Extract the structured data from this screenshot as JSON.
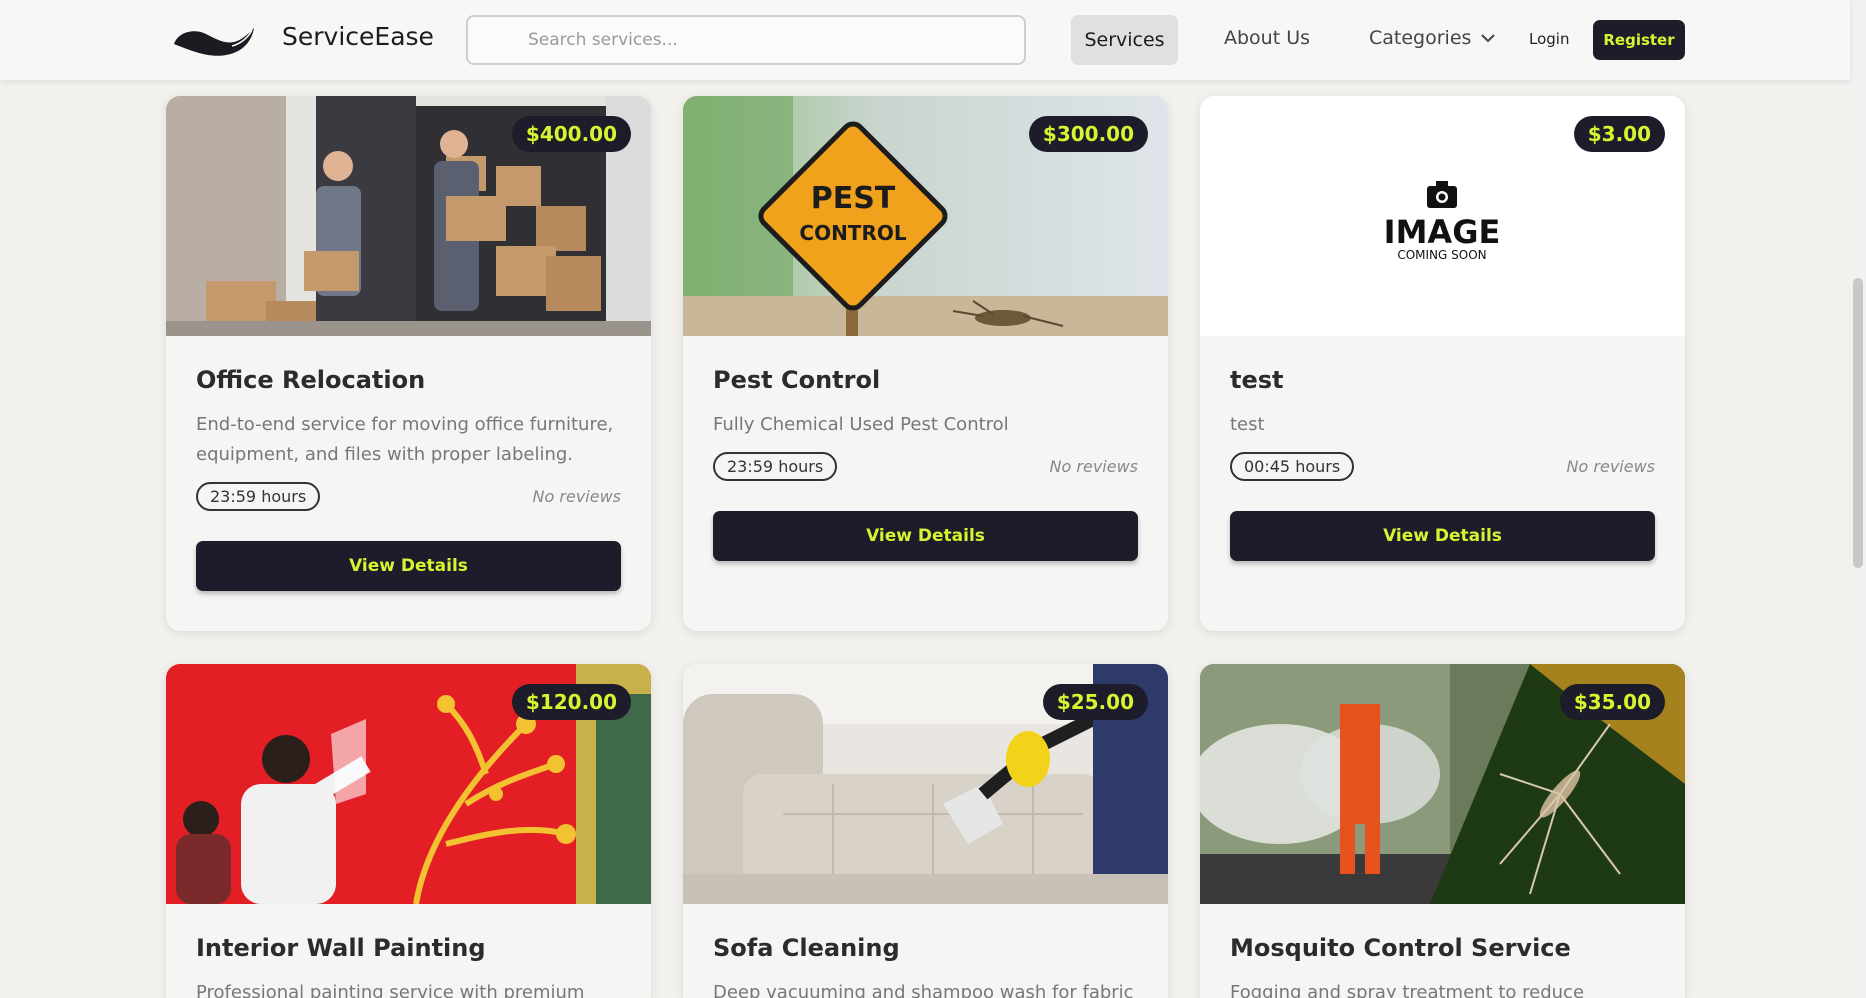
{
  "header": {
    "brand": "ServiceEase",
    "search_placeholder": "Search services...",
    "nav": {
      "services": "Services",
      "about": "About Us",
      "categories": "Categories",
      "login": "Login",
      "register": "Register"
    }
  },
  "cards": [
    {
      "title": "Office Relocation",
      "price": "$400.00",
      "description": "End-to-end service for moving office furniture, equipment, and files with proper labeling.",
      "hours": "23:59 hours",
      "reviews": "No reviews",
      "button": "View Details",
      "image": "movers-van-photo"
    },
    {
      "title": "Pest Control",
      "price": "$300.00",
      "description": "Fully Chemical Used Pest Control",
      "hours": "23:59 hours",
      "reviews": "No reviews",
      "button": "View Details",
      "image": "pest-control-sign-photo",
      "image_text": [
        "PEST",
        "CONTROL"
      ]
    },
    {
      "title": "test",
      "price": "$3.00",
      "description": "test",
      "hours": "00:45 hours",
      "reviews": "No reviews",
      "button": "View Details",
      "image": "image-coming-soon-placeholder",
      "image_text": [
        "IMAGE",
        "COMING SOON"
      ]
    },
    {
      "title": "Interior Wall Painting",
      "price": "$120.00",
      "description": "Professional painting service with premium",
      "image": "wall-painting-photo"
    },
    {
      "title": "Sofa Cleaning",
      "price": "$25.00",
      "description": "Deep vacuuming and shampoo wash for fabric",
      "image": "sofa-cleaning-photo"
    },
    {
      "title": "Mosquito Control Service",
      "price": "$35.00",
      "description": "Fogging and spray treatment to reduce",
      "image": "mosquito-fogging-photo"
    }
  ],
  "colors": {
    "accent": "#d8f431",
    "dark": "#1c1c2a",
    "background": "#f3f1ee"
  }
}
